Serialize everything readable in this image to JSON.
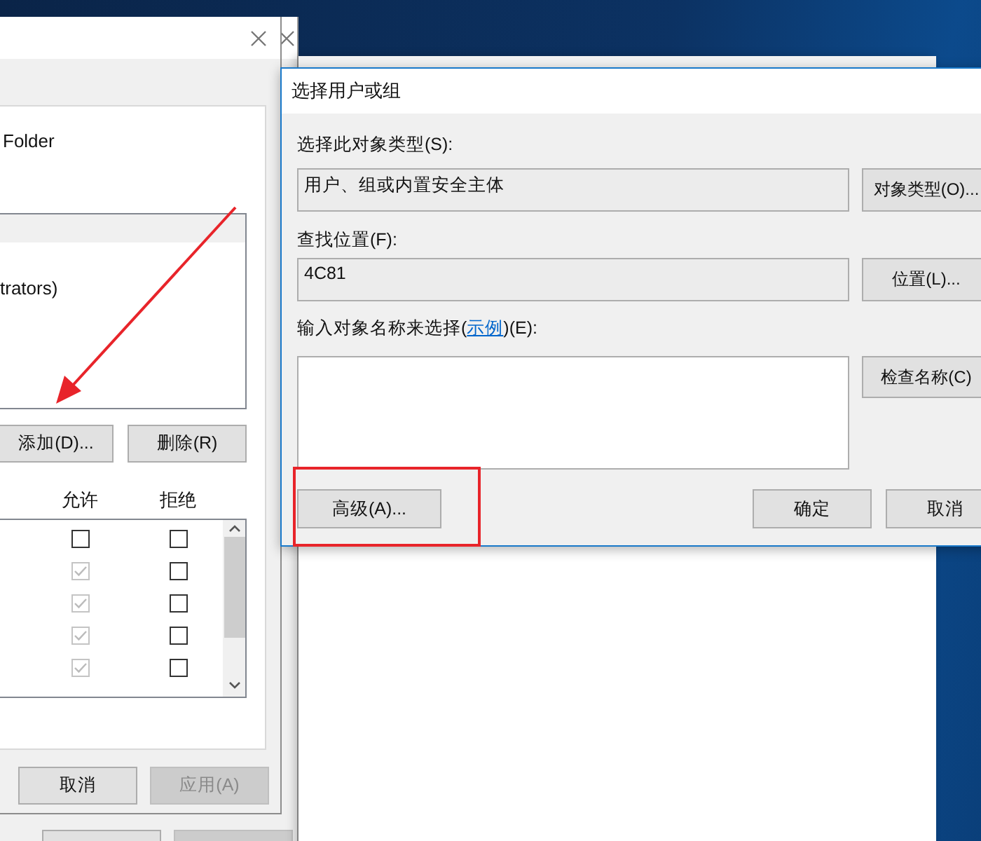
{
  "permissions_dialog": {
    "object_name": "Folder",
    "group_items": [
      "trators)"
    ],
    "group_buttons": [
      "添加(D)...",
      "删除(R)"
    ],
    "columns": [
      "允许",
      "拒绝"
    ],
    "permissions": [
      {
        "allow": {
          "checked": false,
          "disabled": false
        },
        "deny": {
          "checked": false,
          "disabled": false
        }
      },
      {
        "allow": {
          "checked": true,
          "disabled": true
        },
        "deny": {
          "checked": false,
          "disabled": false
        }
      },
      {
        "allow": {
          "checked": true,
          "disabled": true
        },
        "deny": {
          "checked": false,
          "disabled": false
        }
      },
      {
        "allow": {
          "checked": true,
          "disabled": true
        },
        "deny": {
          "checked": false,
          "disabled": false
        }
      },
      {
        "allow": {
          "checked": true,
          "disabled": true
        },
        "deny": {
          "checked": false,
          "disabled": false
        }
      }
    ],
    "buttons": [
      {
        "label": "取消",
        "disabled": false
      },
      {
        "label": "应用(A)",
        "disabled": true
      }
    ]
  },
  "select_dialog": {
    "title": "选择用户或组",
    "object_type_label": "选择此对象类型(S):",
    "object_type": "用户、组或内置安全主体",
    "object_type_button": "对象类型(O)...",
    "location_label": "查找位置(F):",
    "location": "4C81",
    "location_button": "位置(L)...",
    "names_label_before": "输入对象名称来选择(",
    "names_label_link": "示例",
    "names_label_after": ")(E):",
    "check_names_button": "检查名称(C)",
    "advanced_button": "高级(A)...",
    "buttons": [
      "确定",
      "取消"
    ]
  }
}
